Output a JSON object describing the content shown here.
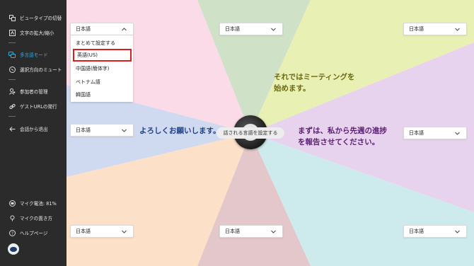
{
  "sidebar": {
    "items": [
      {
        "label": "ビュータイプの切替",
        "icon": "view-switch-icon"
      },
      {
        "label": "文字の拡大/縮小",
        "icon": "text-zoom-icon"
      },
      {
        "label": "多言語モード",
        "icon": "multilingual-icon",
        "active": true
      },
      {
        "label": "選択方向のミュート",
        "icon": "direction-mute-icon"
      },
      {
        "label": "参加者の管理",
        "icon": "participants-icon"
      },
      {
        "label": "ゲストURLの発行",
        "icon": "link-icon"
      },
      {
        "label": "会話から退出",
        "icon": "exit-icon"
      }
    ],
    "bottom": [
      {
        "label": "マイク電池: 81%",
        "icon": "mic-battery-icon"
      },
      {
        "label": "マイクの置き方",
        "icon": "mic-placement-icon"
      },
      {
        "label": "ヘルプページ",
        "icon": "help-icon"
      }
    ],
    "active_color": "#2fb1e6"
  },
  "language_selects": {
    "top_left": "日本語",
    "top_center": "日本語",
    "top_right": "日本語",
    "middle_left": "日本語",
    "middle_right": "日本語",
    "bottom_left": "日本語",
    "bottom_center": "日本語",
    "bottom_right": "日本語"
  },
  "dropdown": {
    "items": [
      "まとめて設定する",
      "英語(US)",
      "中国語(簡体字)",
      "ベトナム語",
      "韓国語"
    ],
    "highlighted_index": 1,
    "highlight_color": "#e01b1b"
  },
  "speech": {
    "left": {
      "lines": [
        "よろしくお願いします。"
      ],
      "color": "#1f3f86"
    },
    "top_right": {
      "lines": [
        "それではミーティングを",
        "始めます。"
      ],
      "color": "#6b6a12"
    },
    "right": {
      "lines": [
        "まずは、私から先週の進捗",
        "を報告させてください。"
      ],
      "color": "#5a1f72"
    }
  },
  "center": {
    "label": "話される言語を設定する"
  },
  "wedge_colors": [
    "#fadbe7",
    "#cfe1c7",
    "#e9f0b4",
    "#e8d3ee",
    "#cdebec",
    "#e3c7cb",
    "#fde0c8",
    "#cfdaf0"
  ]
}
